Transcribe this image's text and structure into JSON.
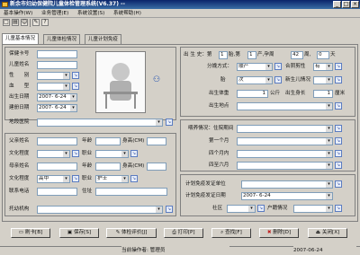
{
  "window": {
    "title": "新余市妇幼保健院儿童体检管理系统(V6.37)  --"
  },
  "menu": [
    "基本操作(W)",
    "业务管理(E)",
    "系统设置(S)",
    "系统帮助(H)"
  ],
  "tabs": [
    "儿童基本情况",
    "儿童体检情况",
    "儿童计划免疫"
  ],
  "left": {
    "health_card_label": "保健卡号",
    "child_name_label": "儿童姓名",
    "gender_label": "性　　别",
    "blood_label": "血　　型",
    "birth_date_label": "出生日期",
    "birth_date_value": "2007- 6-24",
    "build_date_label": "建册日期",
    "build_date_value": "2007- 6-24",
    "area_label": "地段医院",
    "father_name_label": "父亲姓名",
    "age_label": "年龄",
    "height_label": "身高(CM)",
    "education_label": "文化程度",
    "job_label": "职业",
    "mother_name_label": "母亲姓名",
    "mother_age_label": "年龄",
    "mother_height_label": "身高(CM)",
    "mother_edu_label": "文化程度",
    "mother_edu_value": "高中",
    "mother_job_label": "职业",
    "mother_job_value": "护士",
    "phone_label": "联系电话",
    "address_label": "住址",
    "nursery_label": "托幼机构"
  },
  "right": {
    "birth_status_prefix": "出 生 史：第",
    "birth_num": "1",
    "birth_mid": "胎,第",
    "parity_num": "1",
    "parity_mid": "产,孕周",
    "weeks": "42",
    "weeks_mid": "周,",
    "days": "0",
    "days_suffix": "天",
    "delivery_label": "分娩方式：",
    "delivery_value": "顺产",
    "deformity_label": "合阴剪性",
    "deformity_value": "有",
    "fetal_label": "胎",
    "fetal_value": "次",
    "newborn_label": "新生儿情况",
    "birth_weight_label": "出生体重",
    "birth_weight_value": "1",
    "weight_unit": "公斤",
    "birth_length_label": "出生身长",
    "birth_length_value": "1",
    "length_unit": "厘米",
    "birth_place_label": "出生地点",
    "feeding_label": "喂养情况：住院期间",
    "first_month_label": "第一个月",
    "four_month_label": "四个月内",
    "six_month_label": "四至六月",
    "vacc_unit_label": "计划免疫发证单位",
    "vacc_date_label": "计划免疫发证日期",
    "vacc_date_value": "2007- 6-24",
    "community_label": "社区",
    "household_label": "户籍情况"
  },
  "buttons": [
    {
      "label": "刷卡[B]",
      "icon": "card-icon"
    },
    {
      "label": "保存[S]",
      "icon": "save-icon"
    },
    {
      "label": "体检评价[J]",
      "icon": "evaluate-icon"
    },
    {
      "label": "打印[P]",
      "icon": "print-icon"
    },
    {
      "label": "查找[F]",
      "icon": "search-icon"
    },
    {
      "label": "删除[D]",
      "icon": "delete-icon"
    },
    {
      "label": "关闭[X]",
      "icon": "close-icon"
    }
  ],
  "status": {
    "operator": "当前操作者: 管理员",
    "date": "2007-06-24"
  }
}
